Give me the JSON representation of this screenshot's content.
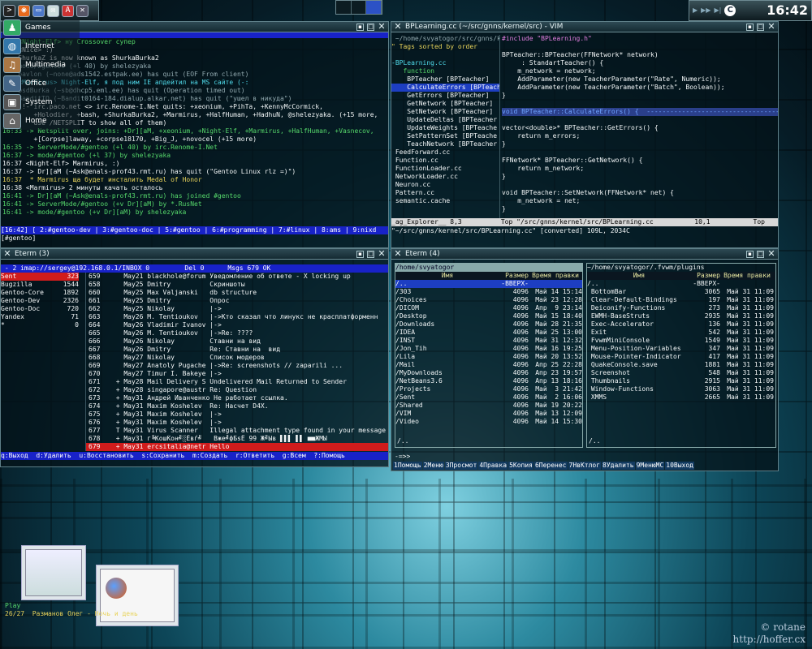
{
  "taskbar": {
    "icons": [
      "terminal-icon",
      "firefox-icon",
      "folder-icon",
      "mail-icon",
      "pdf-icon",
      "tools-icon"
    ]
  },
  "start_menu": {
    "items": [
      {
        "label": "Games",
        "icon": "gamepad-icon"
      },
      {
        "label": "Internet",
        "icon": "globe-icon"
      },
      {
        "label": "Multimedia",
        "icon": "multimedia-icon"
      },
      {
        "label": "Office",
        "icon": "office-icon"
      },
      {
        "label": "System",
        "icon": "system-icon"
      },
      {
        "label": "Home",
        "icon": "home-icon"
      }
    ]
  },
  "clock": {
    "time": "16:42",
    "badge": "C"
  },
  "irc": {
    "lines": [
      {
        "cls": "c-grn",
        "text": "    <Night-Elf> ну Crossover супер"
      },
      {
        "cls": "c-wht",
        "text": "    <Nice> :)"
      },
      {
        "cls": "c-wht",
        "text": "    ShurkaZ is now known as ShurkaBurka2"
      },
      {
        "cls": "c-gry",
        "text": "    mode/#gentoo (+l 40) by shelezyaka"
      },
      {
        "cls": "c-gry",
        "text": "    pavlon (~none@ads1542.estpak.ee) has quit (EOF From client)"
      },
      {
        "cls": "c-cyn",
        "text": "    <Marmirus> Night-Elf, я под ним IE апдейтил на MS сайте (-:"
      },
      {
        "cls": "c-gry",
        "text": "    bsdBurka (~sb@dhcp5.eml.ee) has quit (Operation timed out)"
      },
      {
        "cls": "c-gry",
        "text": "    BanditTO (~Bandit0164-184.dialup.alkar.net) has quit (\"ушел в никуда\")"
      },
      {
        "cls": "c-wht",
        "text": "    -!- irc.paco.net <> irc.Renome-I.Net quits: +xeonium, +PihTa, +KennyMcCormick,"
      },
      {
        "cls": "c-wht",
        "text": "        +Holodier, +bash, +ShurkaBurka2, +Marmirus, +HalfHuman, +HadhuN, @shelezyaka. (+15 more,"
      },
      {
        "cls": "c-wht",
        "text": "        use /NETSPLIT to show all of them)"
      },
      {
        "cls": "c-grn",
        "text": "16:33 -> Netsplit over, joins: +Dr][aM, +xeonium, +Night-Elf, +Marmirus, +HalfHuman, +Vasnecov,"
      },
      {
        "cls": "c-wht",
        "text": "        +[Corpse]laway, +corpse18170, +Big_J, +novocel (+15 more)"
      },
      {
        "cls": "c-grn",
        "text": "16:35 -> ServerMode/#gentoo (+l 40) by irc.Renome-I.Net"
      },
      {
        "cls": "c-grn",
        "text": "16:37 -> mode/#gentoo (+l 37) by shelezyaka"
      },
      {
        "cls": "c-wht",
        "text": "16:37 <Night-Elf> Marmirus, :)"
      },
      {
        "cls": "c-wht",
        "text": "16:37 -> Dr][aM (~Ask@enals-prof43.rmt.ru) has quit (\"Gentoo Linux rlz =)\")"
      },
      {
        "cls": "c-yel",
        "text": "16:37  * Marmirus ща будет инсталить Medal of Honor"
      },
      {
        "cls": "c-wht",
        "text": "16:38 <Marmirus> 2 минуты качать осталось"
      },
      {
        "cls": "c-grn",
        "text": "16:41 -> Dr][aM (~Ask@enals-prof43.rmt.ru) has joined #gentoo"
      },
      {
        "cls": "c-grn",
        "text": "16:41 -> ServerMode/#gentoo (+v Dr][aM) by *.RusNet"
      },
      {
        "cls": "c-grn",
        "text": "16:41 -> mode/#gentoo (+v Dr][aM) by shelezyaka"
      }
    ],
    "statusbar": "[16:42] [ 2:#gentoo-dev | 3:#gentoo-doc | 5:#gentoo | 6:#programming | 7:#linux | 8:ams | 9:nixd",
    "prompt": "[#gentoo] "
  },
  "vim": {
    "title": "BPLearning.cc (~/src/gnns/kernel/src) - VIM",
    "tree": [
      {
        "cls": "c-gry",
        "text": " ~/home/svyatogor/src/gnns/ke"
      },
      {
        "cls": "c-yel",
        "text": "\" Tags sorted by order"
      },
      {
        "cls": "c-wht",
        "text": ""
      },
      {
        "cls": "c-cyn",
        "text": "-BPLearning.cc"
      },
      {
        "cls": "c-grn",
        "text": "   function"
      },
      {
        "cls": "c-wht",
        "text": "    BPTeacher [BPTeacher]"
      },
      {
        "cls": "hl-sel",
        "text": "    CalculateErrors [BPTeache"
      },
      {
        "cls": "c-wht",
        "text": "    GetErrors [BPTeacher]"
      },
      {
        "cls": "c-wht",
        "text": "    GetNetwork [BPTeacher]"
      },
      {
        "cls": "c-wht",
        "text": "    SetNetwork [BPTeacher]"
      },
      {
        "cls": "c-wht",
        "text": "    UpdateDeltas [BPTeacher"
      },
      {
        "cls": "c-wht",
        "text": "    UpdateWeights [BPTeache"
      },
      {
        "cls": "c-wht",
        "text": "    SetPatternSet [BPTeache"
      },
      {
        "cls": "c-wht",
        "text": "    TeachNetwork [BPTeacher"
      },
      {
        "cls": "c-wht",
        "text": " FeedForward.cc"
      },
      {
        "cls": "c-wht",
        "text": " Function.cc"
      },
      {
        "cls": "c-wht",
        "text": " FunctionLoader.cc"
      },
      {
        "cls": "c-wht",
        "text": " NetworkLoader.cc"
      },
      {
        "cls": "c-wht",
        "text": " Neuron.cc"
      },
      {
        "cls": "c-wht",
        "text": " Pattern.cc"
      },
      {
        "cls": "c-wht",
        "text": " semantic.cache"
      }
    ],
    "code": [
      {
        "cls": "c-mag",
        "text": "#include \"BPLearning.h\""
      },
      {
        "cls": "c-wht",
        "text": ""
      },
      {
        "cls": "c-wht",
        "text": "BPTeacher::BPTeacher(FFNetwork* network)"
      },
      {
        "cls": "c-wht",
        "text": "     : StandartTeacher() {"
      },
      {
        "cls": "c-wht",
        "text": "    m_network = network;"
      },
      {
        "cls": "c-wht",
        "text": "    AddParameter(new TeacherParameter(\"Rate\", Numeric));"
      },
      {
        "cls": "c-wht",
        "text": "    AddParameter(new TeacherParameter(\"Batch\", Boolean));"
      },
      {
        "cls": "c-wht",
        "text": "}"
      },
      {
        "cls": "c-wht",
        "text": ""
      },
      {
        "cls": "c-blu",
        "text": "void BPTeacher::CalculateErrors() {  -----------------------------------------"
      },
      {
        "cls": "c-wht",
        "text": ""
      },
      {
        "cls": "c-wht",
        "text": "vector<double>* BPTeacher::GetErrors() {"
      },
      {
        "cls": "c-wht",
        "text": "    return m_errors;"
      },
      {
        "cls": "c-wht",
        "text": "}"
      },
      {
        "cls": "c-wht",
        "text": ""
      },
      {
        "cls": "c-wht",
        "text": "FFNetwork* BPTeacher::GetNetwork() {"
      },
      {
        "cls": "c-wht",
        "text": "    return m_network;"
      },
      {
        "cls": "c-wht",
        "text": "}"
      },
      {
        "cls": "c-wht",
        "text": ""
      },
      {
        "cls": "c-wht",
        "text": "void BPTeacher::SetNetwork(FFNetwork* net) {"
      },
      {
        "cls": "c-wht",
        "text": "    m_network = net;"
      },
      {
        "cls": "c-wht",
        "text": "}"
      }
    ],
    "status_left": "_ag_Explorer__ 8,3          Top \"/src/gnns/kernel/src/BPLearning.cc",
    "status_right": "10,1           Top",
    "cmdline": "\"~/src/gnns/kernel/src/BPLearning.cc\" [converted] 109L, 2034C"
  },
  "mutt": {
    "title": "Eterm (3)",
    "header": " - 2 imap://sergey@192.168.0.1/INBOX 0         Del 0      Msgs 679 OK                                 (end)",
    "folders": [
      {
        "name": "Sent",
        "count": "323"
      },
      {
        "name": "Bugzilla",
        "count": "1544"
      },
      {
        "name": "Gentoo-Core",
        "count": "1892"
      },
      {
        "name": "Gentoo-Dev",
        "count": "2326"
      },
      {
        "name": "Gentoo-Doc",
        "count": "720"
      },
      {
        "name": "Yandex",
        "count": "71"
      },
      {
        "name": "*",
        "count": "0"
      }
    ],
    "messages": [
      "659      May21 blackhole@forum Уведомление об ответе - X locking up",
      "658      May25 Dmitry          Скриншоты",
      "660      May25 Max Valjanski   db structure",
      "661      May25 Dmitry          Опрос",
      "662      May25 Nikolay         |->",
      "663      May26 M. Tentioukov   |->Кто сказал что линукс не красплатформенн",
      "664      May26 Vladimir Ivanov |->",
      "665      May26 M. Tentioukov   |->Re: ????",
      "666      May26 Nikolay         Ставни на вид",
      "667      May26 Dmitry          Re: Ставни на  вид",
      "668      May27 Nikolay         Список модеров",
      "669      May27 Anatoly Pugache |->Re: screenshots // zaparili ...",
      "670      May27 Timur I. Bakeye |->",
      "671    + May28 Mail Delivery S Undelivered Mail Returned to Sender",
      "672    + May28 singapore@austr Re: Question",
      "673    + May31 Андрей Иванченко Не работает ссылка.",
      "674    + May31 Maxim Koshelev  Re: Насчет D4X.",
      "675    + May31 Maxim Koshelev  |->",
      "676    + May31 Maxim Koshelev  |->",
      "677    T May31 Virus Scanner   Illegal attachment type found in your message \"pr",
      "678    + May31 г╚КошЌон╝░Ёвѓ╝   Вже╝фБѕЁ 99 Ж╝Ыв ▌▌▌ ▌▌ ■■ЖМЫ",
      "679    + May31 ercsitalia@netr Hello"
    ],
    "footer": "q:Выход  d:Удалить  u:Восстановить  s:Сохранить  m:Создать  r:Ответить  g:Всем  ?:Помощь"
  },
  "mc": {
    "title": "Eterm (4)",
    "left_path": "/home/svyatogor",
    "right_path": "~/home/svyatogor/.fvwm/plugins",
    "col_name": "Имя",
    "col_size": "Размер",
    "col_time": "Время правки",
    "left_rows": [
      {
        "name": "/..",
        "size": "-ВВЕРХ-",
        "time": "",
        "sel": true
      },
      {
        "name": "/303",
        "size": "4096",
        "time": "Май 14 15:14"
      },
      {
        "name": "/Choices",
        "size": "4096",
        "time": "Май 23 12:28"
      },
      {
        "name": "/DICOM",
        "size": "4096",
        "time": "Апр  9 23:14"
      },
      {
        "name": "/Desktop",
        "size": "4096",
        "time": "Май 15 18:40"
      },
      {
        "name": "/Downloads",
        "size": "4096",
        "time": "Май 28 21:35"
      },
      {
        "name": "/IDEA",
        "size": "4096",
        "time": "Май 25 13:00"
      },
      {
        "name": "/INST",
        "size": "4096",
        "time": "Май 31 12:32"
      },
      {
        "name": "/Jon_Tih",
        "size": "4096",
        "time": "Май 16 19:25"
      },
      {
        "name": "/Lila",
        "size": "4096",
        "time": "Май 20 13:52"
      },
      {
        "name": "/Mail",
        "size": "4096",
        "time": "Апр 25 22:28"
      },
      {
        "name": "/MyDownloads",
        "size": "4096",
        "time": "Апр 23 19:57"
      },
      {
        "name": "/NetBeans3.6",
        "size": "4096",
        "time": "Апр 13 18:16"
      },
      {
        "name": "/Projects",
        "size": "4096",
        "time": "Май  3 21:42"
      },
      {
        "name": "/Sent",
        "size": "4096",
        "time": "Май  2 16:06"
      },
      {
        "name": "/Shared",
        "size": "4096",
        "time": "Май 19 20:22"
      },
      {
        "name": "/VIM",
        "size": "4096",
        "time": "Май 13 12:09"
      },
      {
        "name": "/Video",
        "size": "4096",
        "time": "Май 14 15:30"
      }
    ],
    "right_rows": [
      {
        "name": "/..",
        "size": "-ВВЕРХ-",
        "time": ""
      },
      {
        "name": " BottomBar",
        "size": "3065",
        "time": "Май 31 11:09"
      },
      {
        "name": " Clear-Default-Bindings",
        "size": "197",
        "time": "Май 31 11:09"
      },
      {
        "name": " Deiconify-Functions",
        "size": "273",
        "time": "Май 31 11:09"
      },
      {
        "name": " EWMH-BaseStruts",
        "size": "2935",
        "time": "Май 31 11:09"
      },
      {
        "name": " Exec-Accelerator",
        "size": "136",
        "time": "Май 31 11:09"
      },
      {
        "name": " Exit",
        "size": "542",
        "time": "Май 31 11:09"
      },
      {
        "name": " FvwmMiniConsole",
        "size": "1549",
        "time": "Май 31 11:09"
      },
      {
        "name": " Menu-Position-Variables",
        "size": "347",
        "time": "Май 31 11:09"
      },
      {
        "name": " Mouse-Pointer-Indicator",
        "size": "417",
        "time": "Май 31 11:09"
      },
      {
        "name": " QuakeConsole.save",
        "size": "1881",
        "time": "Май 31 11:09"
      },
      {
        "name": " Screenshot",
        "size": "548",
        "time": "Май 31 11:09"
      },
      {
        "name": " Thumbnails",
        "size": "2915",
        "time": "Май 31 11:09"
      },
      {
        "name": " Window-Functions",
        "size": "3063",
        "time": "Май 31 11:09"
      },
      {
        "name": " XMMS",
        "size": "2665",
        "time": "Май 31 11:09"
      }
    ],
    "left_footer": "/..",
    "right_footer": "/..",
    "prompt": "-=>> ",
    "fkeys": [
      "1Помощь",
      "2Меню",
      "3Просмот",
      "4Правка",
      "5Копия",
      "6Перенес",
      "7НвКтлог",
      "8Удалить",
      "9МенюМС",
      "10Выход"
    ]
  },
  "thumbnails": {
    "caption_left": "Play",
    "caption": "26/27  Разманов Олег - Ночь и день"
  },
  "watermark": {
    "line1": "© rotane",
    "line2": "http://hoffer.cx"
  }
}
